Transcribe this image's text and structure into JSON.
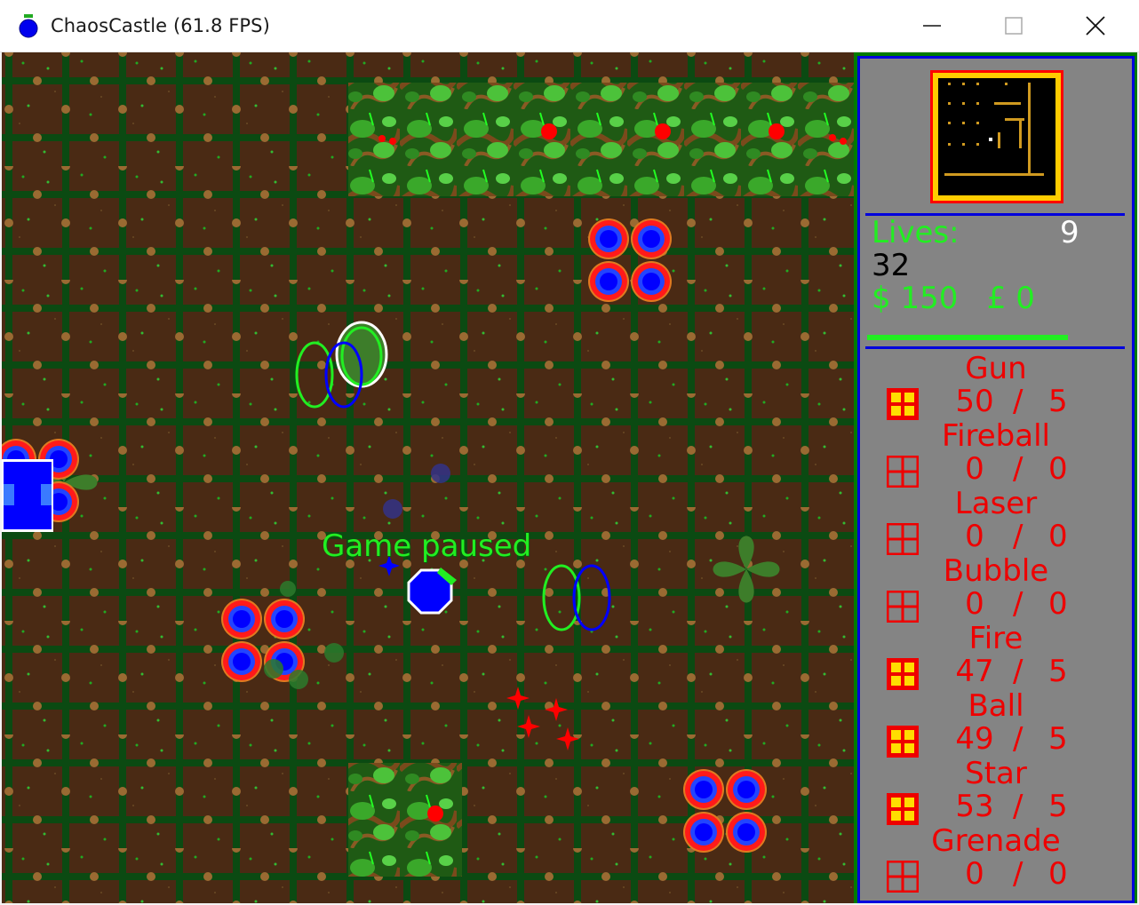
{
  "window": {
    "title": "ChaosCastle (61.8 FPS)",
    "minimize_glyph": "—",
    "close_glyph": "✕"
  },
  "game": {
    "status_text": "Game paused"
  },
  "hud": {
    "lives_label": "Lives:",
    "lives_value": "9",
    "score": "32",
    "money": "$ 150   £ 0",
    "energy_fraction": 0.78,
    "weapons": [
      {
        "name": "Gun",
        "count": "50",
        "max": "5",
        "icon": "filled"
      },
      {
        "name": "Fireball",
        "count": "0",
        "max": "0",
        "icon": "empty"
      },
      {
        "name": "Laser",
        "count": "0",
        "max": "0",
        "icon": "empty"
      },
      {
        "name": "Bubble",
        "count": "0",
        "max": "0",
        "icon": "empty"
      },
      {
        "name": "Fire",
        "count": "47",
        "max": "5",
        "icon": "filled"
      },
      {
        "name": "Ball",
        "count": "49",
        "max": "5",
        "icon": "filled"
      },
      {
        "name": "Star",
        "count": "53",
        "max": "5",
        "icon": "filled"
      },
      {
        "name": "Grenade",
        "count": "0",
        "max": "0",
        "icon": "empty"
      }
    ]
  },
  "colors": {
    "hud_background": "#848484",
    "hud_border": "#0000dd",
    "hud_green": "#22ee22",
    "hud_red": "#ee0000",
    "ground": "#4a2a14",
    "grid": "#0b4a12",
    "player": "#0000ff"
  }
}
